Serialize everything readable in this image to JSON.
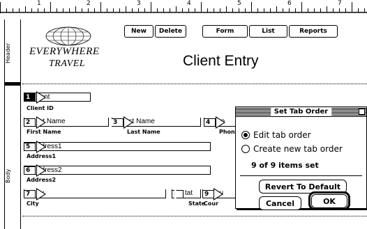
{
  "ruler": {
    "numbers": [
      "1",
      "2",
      "3",
      "4",
      "5",
      "6",
      "7"
    ]
  },
  "parts": {
    "header": "Header",
    "body": "Body"
  },
  "toolbar": {
    "new_label": "New",
    "delete_label": "Delete",
    "form_label": "Form",
    "list_label": "List",
    "reports_label": "Reports"
  },
  "logo": {
    "line1": "EVERYWHERE",
    "line2": "TRAVEL",
    "icon": "globe-icon"
  },
  "title": "Client Entry",
  "fields": [
    {
      "num": "1",
      "text": "lient",
      "label": "Client ID"
    },
    {
      "num": "2",
      "text": "rst Name",
      "label": "First Name"
    },
    {
      "num": "3",
      "text": "ast Name",
      "label": "Last Name"
    },
    {
      "num": "4",
      "text": "ho",
      "label": "Phon"
    },
    {
      "num": "5",
      "text": "ddress1",
      "label": "Address1"
    },
    {
      "num": "6",
      "text": "ddress2",
      "label": "Address2"
    },
    {
      "num": "7",
      "text": "ity",
      "label": "City"
    },
    {
      "num": "8",
      "text": "tat",
      "label": "State"
    },
    {
      "num": "9",
      "text": "ou",
      "label": "Cour"
    }
  ],
  "dialog": {
    "title": "Set Tab Order",
    "options": [
      "Edit tab order",
      "Create new tab order"
    ],
    "selected_option": "Edit tab order",
    "status": "9 of 9 items set",
    "revert_label": "Revert To Default",
    "cancel_label": "Cancel",
    "ok_label": "OK"
  }
}
